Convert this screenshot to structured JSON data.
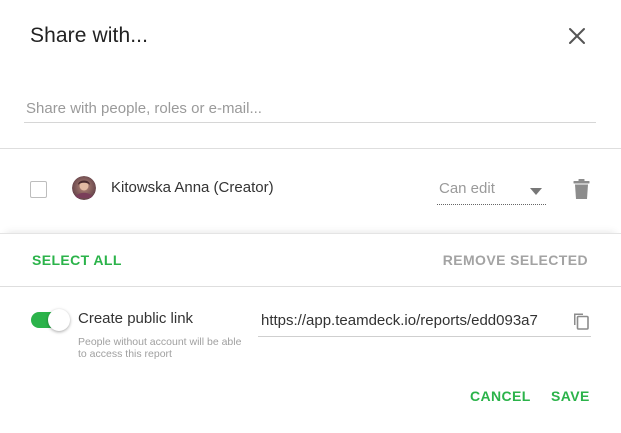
{
  "dialog": {
    "title": "Share with...",
    "close_icon": "close-icon"
  },
  "search": {
    "placeholder": "Share with people, roles or e-mail...",
    "value": ""
  },
  "members": [
    {
      "name": "Kitowska Anna (Creator)",
      "checked": false,
      "role": "Can edit",
      "avatar_icon": "user-avatar",
      "delete_icon": "trash-icon"
    }
  ],
  "bulk_actions": {
    "select_all_label": "SELECT ALL",
    "remove_selected_label": "REMOVE SELECTED"
  },
  "public_link": {
    "enabled": true,
    "label": "Create public link",
    "help_text": "People without account will be able to access this report",
    "url": "https://app.teamdeck.io/reports/edd093a7",
    "copy_icon": "copy-icon"
  },
  "footer": {
    "cancel_label": "CANCEL",
    "save_label": "SAVE"
  },
  "colors": {
    "accent": "#2bb34a",
    "muted_text": "#a3a3a3",
    "divider": "#dedede"
  }
}
